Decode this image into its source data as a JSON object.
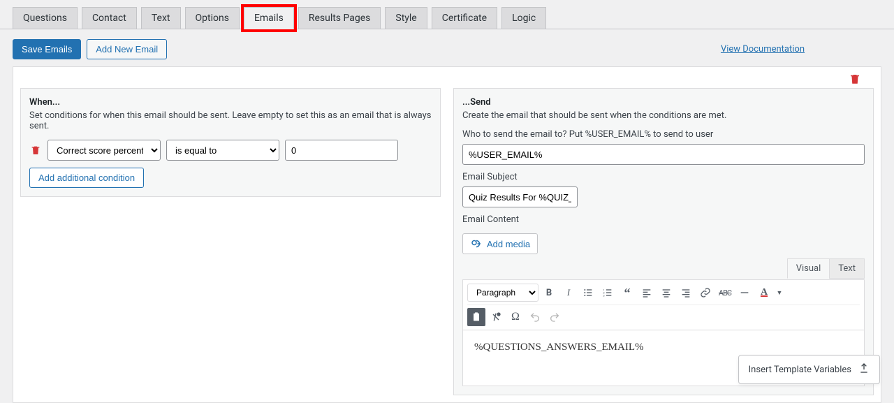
{
  "tabs": [
    "Questions",
    "Contact",
    "Text",
    "Options",
    "Emails",
    "Results Pages",
    "Style",
    "Certificate",
    "Logic"
  ],
  "activeTabIndex": 4,
  "highlightedTabIndex": 4,
  "buttons": {
    "save": "Save Emails",
    "addNew": "Add New Email",
    "docLink": "View Documentation",
    "addCond": "Add additional condition",
    "addMedia": "Add media",
    "insertVars": "Insert Template Variables"
  },
  "when": {
    "title": "When...",
    "desc": "Set conditions for when this email should be sent. Leave empty to set this as an email that is always sent.",
    "condition": {
      "fieldSelected": "Correct score percentage",
      "operatorSelected": "is equal to",
      "value": "0"
    }
  },
  "send": {
    "title": "...Send",
    "desc": "Create the email that should be sent when the conditions are met.",
    "toLabel": "Who to send the email to? Put %USER_EMAIL% to send to user",
    "toValue": "%USER_EMAIL%",
    "subjectLabel": "Email Subject",
    "subjectValue": "Quiz Results For %QUIZ_NAME%",
    "contentLabel": "Email Content",
    "editorTabs": {
      "visual": "Visual",
      "text": "Text"
    },
    "paragraphSel": "Paragraph",
    "body": "%QUESTIONS_ANSWERS_EMAIL%"
  }
}
